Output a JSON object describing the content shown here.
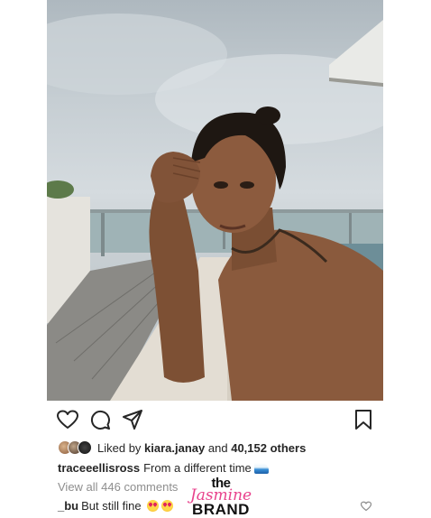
{
  "post": {
    "photo_alt": "",
    "likes": {
      "prefix": "Liked by",
      "user": "kiara.janay",
      "and_text": "and",
      "count": "40,152 others"
    },
    "caption": {
      "user": "traceeellisross",
      "text": "From a different time"
    },
    "view_all": "View all 446 comments",
    "comment": {
      "user": "_bu",
      "text": "But still fine"
    }
  },
  "watermark": {
    "line1": "the",
    "line2": "Jasmine",
    "line3": "BRAND"
  },
  "icons": {
    "like": "heart-icon",
    "comment": "comment-icon",
    "share": "share-icon",
    "save": "bookmark-icon"
  },
  "colors": {
    "text": "#262626",
    "muted": "#8e8e8e",
    "watermark_pink": "#e8428c"
  }
}
